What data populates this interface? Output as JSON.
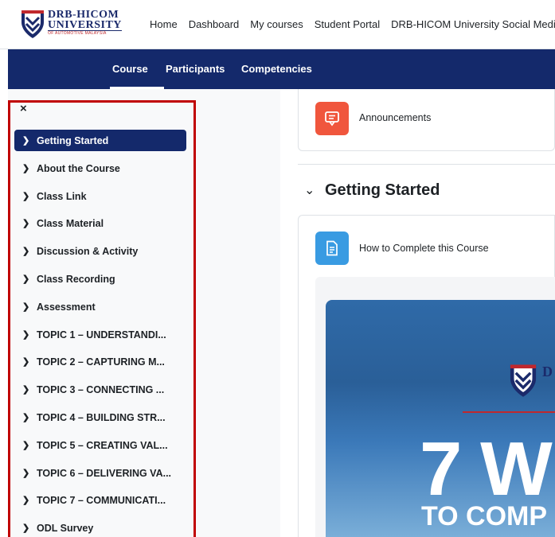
{
  "logo": {
    "line1": "DRB-HICOM",
    "line2": "UNIVERSITY",
    "line3": "OF AUTOMOTIVE MALAYSIA"
  },
  "topnav": {
    "items": [
      "Home",
      "Dashboard",
      "My courses",
      "Student Portal",
      "DRB-HICOM University Social Media"
    ]
  },
  "secondary_nav": {
    "tabs": [
      "Course",
      "Participants",
      "Competencies"
    ],
    "active": "Course"
  },
  "course_index": {
    "close_symbol": "×",
    "items": [
      "Getting Started",
      "About the Course",
      "Class Link",
      "Class Material",
      "Discussion & Activity",
      "Class Recording",
      "Assessment",
      "TOPIC 1 – UNDERSTANDI...",
      "TOPIC 2 – CAPTURING M...",
      "TOPIC 3 – CONNECTING ...",
      "TOPIC 4 – BUILDING STR...",
      "TOPIC 5 – CREATING VAL...",
      "TOPIC 6 – DELIVERING VA...",
      "TOPIC 7 – COMMUNICATI...",
      "ODL Survey"
    ],
    "active_index": 0
  },
  "main": {
    "announcements_label": "Announcements",
    "section_title": "Getting Started",
    "page_activity_label": "How to Complete this Course",
    "banner": {
      "logo_fragment": "D",
      "headline_fragment": "7 W",
      "subline_fragment": "TO COMP"
    }
  },
  "colors": {
    "navy": "#14296b",
    "forum_icon": "#f0563d",
    "page_icon": "#399be2",
    "highlight": "#c00000"
  }
}
